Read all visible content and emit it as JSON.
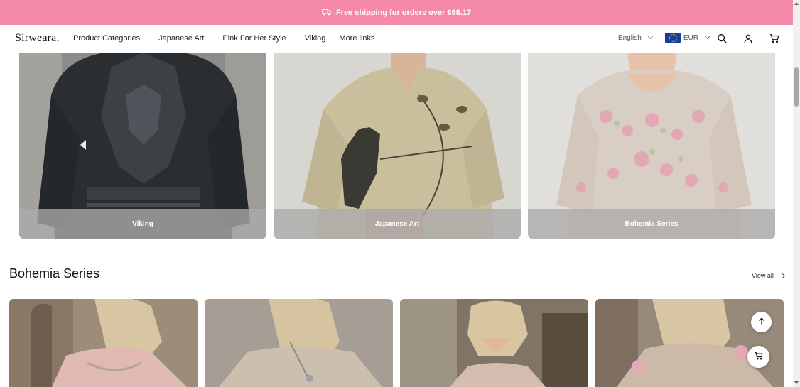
{
  "announcement": {
    "text": "Free shipping for orders over €68.17",
    "icon": "truck-icon",
    "background": "#f48aa7"
  },
  "header": {
    "logo": "Sirweara.",
    "nav": [
      "Product Categories",
      "Japanese Art",
      "Pink For Her Style",
      "Viking",
      "More links"
    ],
    "language": "English",
    "currency": "EUR",
    "icons": [
      "search-icon",
      "account-icon",
      "cart-icon"
    ]
  },
  "collections": [
    {
      "label": "Viking"
    },
    {
      "label": "Japanese Art"
    },
    {
      "label": "Bohemia Series"
    }
  ],
  "section": {
    "title": "Bohemia Series",
    "view_all": "View all"
  },
  "floating": {
    "back_to_top": "arrow-up-icon",
    "cart": "cart-icon"
  }
}
